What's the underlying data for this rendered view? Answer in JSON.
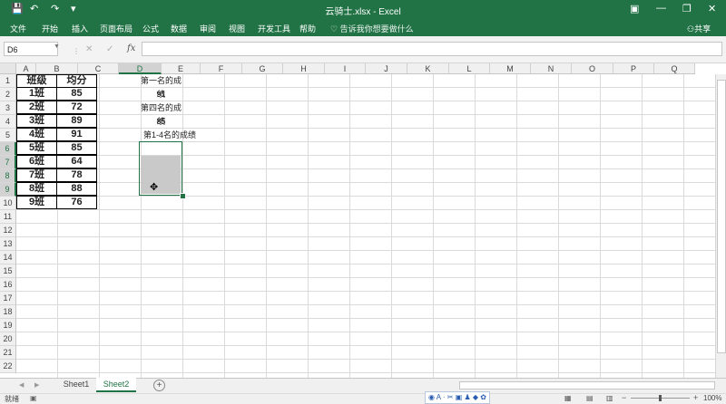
{
  "window": {
    "title": "云骑士.xlsx - Excel",
    "save_icon": "💾",
    "undo_icon": "↶",
    "redo_icon": "↷",
    "customize_icon": "▾",
    "ribbon_display_icon": "▣",
    "minimize": "—",
    "restore": "❐",
    "close": "✕"
  },
  "ribbon": {
    "tabs": [
      "文件",
      "开始",
      "插入",
      "页面布局",
      "公式",
      "数据",
      "审阅",
      "视图",
      "开发工具",
      "帮助"
    ],
    "tell_me": "告诉我你想要做什么",
    "share": "共享"
  },
  "formula_bar": {
    "name_box": "D6",
    "fx": "fx",
    "value": ""
  },
  "columns": [
    "A",
    "B",
    "C",
    "D",
    "E",
    "F",
    "G",
    "H",
    "I",
    "J",
    "K",
    "L",
    "M",
    "N",
    "O",
    "P",
    "Q"
  ],
  "rows": [
    "1",
    "2",
    "3",
    "4",
    "5",
    "6",
    "7",
    "8",
    "9",
    "10",
    "11",
    "12",
    "13",
    "14",
    "15",
    "16",
    "17",
    "18",
    "19",
    "20",
    "21",
    "22"
  ],
  "table": {
    "headers": [
      "班级",
      "均分"
    ],
    "rows": [
      [
        "1班",
        "85"
      ],
      [
        "2班",
        "72"
      ],
      [
        "3班",
        "89"
      ],
      [
        "4班",
        "91"
      ],
      [
        "5班",
        "85"
      ],
      [
        "6班",
        "64"
      ],
      [
        "7班",
        "78"
      ],
      [
        "8班",
        "88"
      ],
      [
        "9班",
        "76"
      ]
    ]
  },
  "d_column": {
    "d1": "第一名的成绩",
    "d2": "91",
    "d3": "第四名的成绩",
    "d4": "85",
    "d5": "第1-4名的成绩"
  },
  "sheets": [
    "Sheet1",
    "Sheet2"
  ],
  "active_sheet": "Sheet2",
  "status": {
    "ready": "就绪",
    "zoom": "100%"
  },
  "colors": {
    "accent": "#217346"
  }
}
